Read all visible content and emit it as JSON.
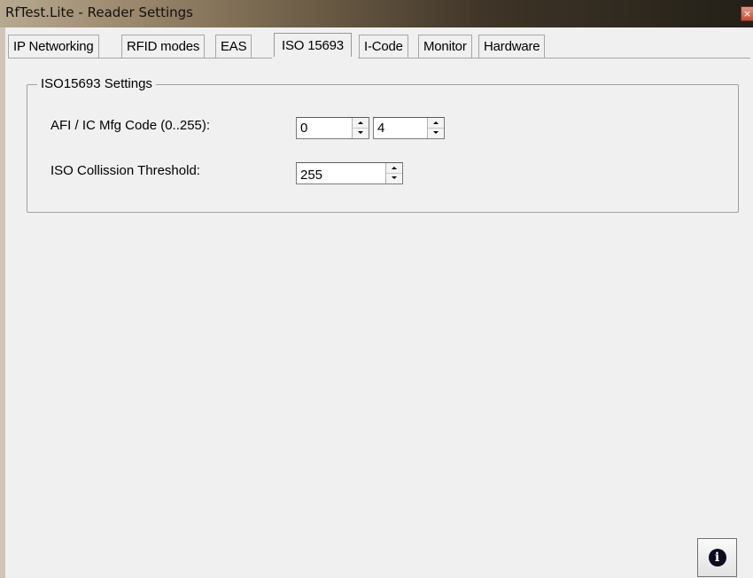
{
  "window": {
    "title": "RfTest.Lite - Reader Settings",
    "close_glyph": "×"
  },
  "tabs": [
    {
      "label": "IP Networking"
    },
    {
      "label": "RFID modes"
    },
    {
      "label": "EAS"
    },
    {
      "label": "ISO 15693",
      "active": true
    },
    {
      "label": "I-Code"
    },
    {
      "label": "Monitor"
    },
    {
      "label": "Hardware"
    }
  ],
  "group": {
    "title": "ISO15693 Settings",
    "afi_label": "AFI / IC Mfg Code (0..255):",
    "afi_value": "0",
    "mfg_value": "4",
    "threshold_label": "ISO Collission Threshold:",
    "threshold_value": "255"
  },
  "info_button": {
    "icon": "info-icon",
    "glyph": "i"
  }
}
